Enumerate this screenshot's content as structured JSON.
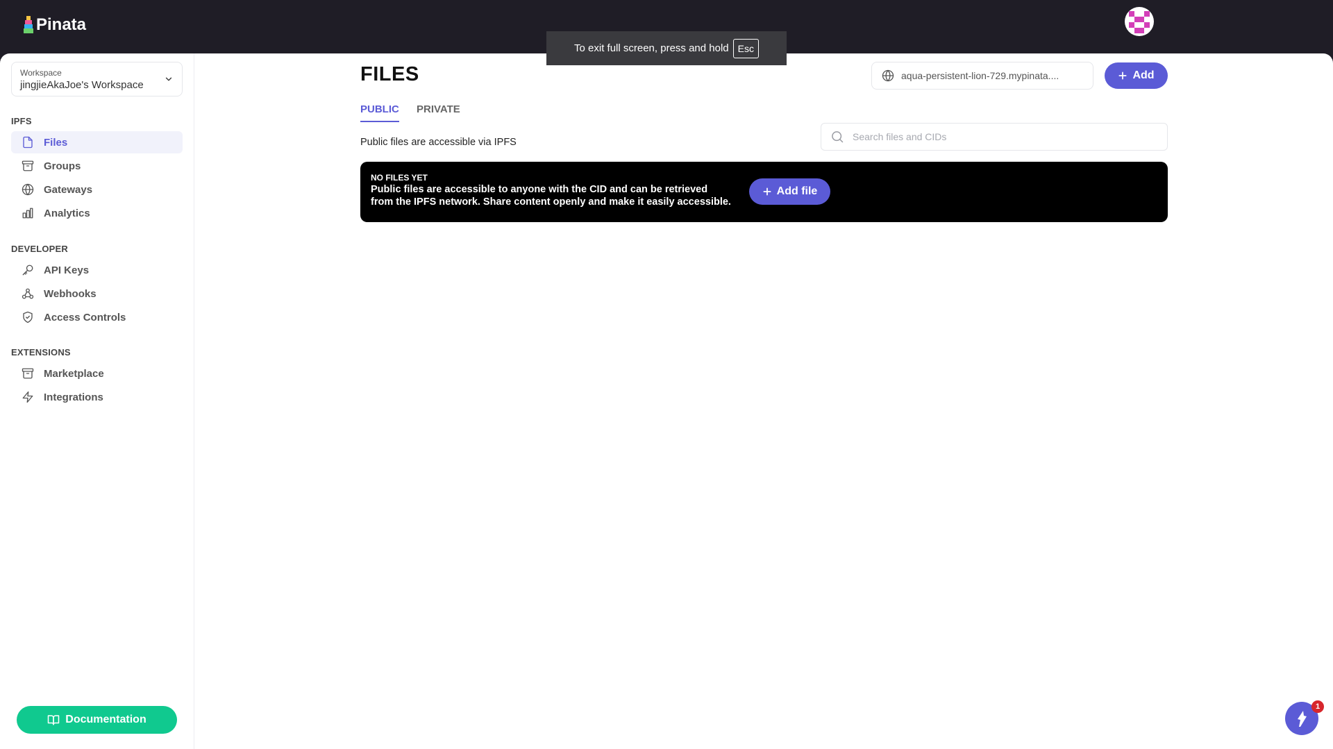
{
  "app": {
    "brand": "Pinata"
  },
  "fullscreen_toast": {
    "text": "To exit full screen, press and hold",
    "key": "Esc"
  },
  "workspace": {
    "label": "Workspace",
    "value": "jingjieAkaJoe's Workspace"
  },
  "sidebar": {
    "sections": [
      {
        "title": "IPFS",
        "items": [
          {
            "label": "Files",
            "icon": "file-icon",
            "active": true
          },
          {
            "label": "Groups",
            "icon": "archive-icon"
          },
          {
            "label": "Gateways",
            "icon": "globe-icon"
          },
          {
            "label": "Analytics",
            "icon": "bar-chart-icon"
          }
        ]
      },
      {
        "title": "DEVELOPER",
        "items": [
          {
            "label": "API Keys",
            "icon": "key-icon"
          },
          {
            "label": "Webhooks",
            "icon": "webhook-icon"
          },
          {
            "label": "Access Controls",
            "icon": "shield-check-icon"
          }
        ]
      },
      {
        "title": "EXTENSIONS",
        "items": [
          {
            "label": "Marketplace",
            "icon": "archive-icon"
          },
          {
            "label": "Integrations",
            "icon": "zap-icon"
          }
        ]
      }
    ],
    "documentation_label": "Documentation"
  },
  "main": {
    "title": "FILES",
    "gateway": "aqua-persistent-lion-729.mypinata....",
    "add_label": "Add",
    "tabs": [
      {
        "label": "PUBLIC",
        "active": true
      },
      {
        "label": "PRIVATE",
        "active": false
      }
    ],
    "subtitle": "Public files are accessible via IPFS",
    "search_placeholder": "Search files and CIDs",
    "empty_state": {
      "title": "NO FILES YET",
      "text": "Public files are accessible to anyone with the CID and can be retrieved from the IPFS network. Share content openly and make it easily accessible.",
      "button_label": "Add file"
    }
  },
  "chat": {
    "badge_count": "1"
  },
  "colors": {
    "accent": "#5b5bd6",
    "docs_green": "#10c98f",
    "topbar": "#1f1d26",
    "badge_red": "#d7262c"
  }
}
